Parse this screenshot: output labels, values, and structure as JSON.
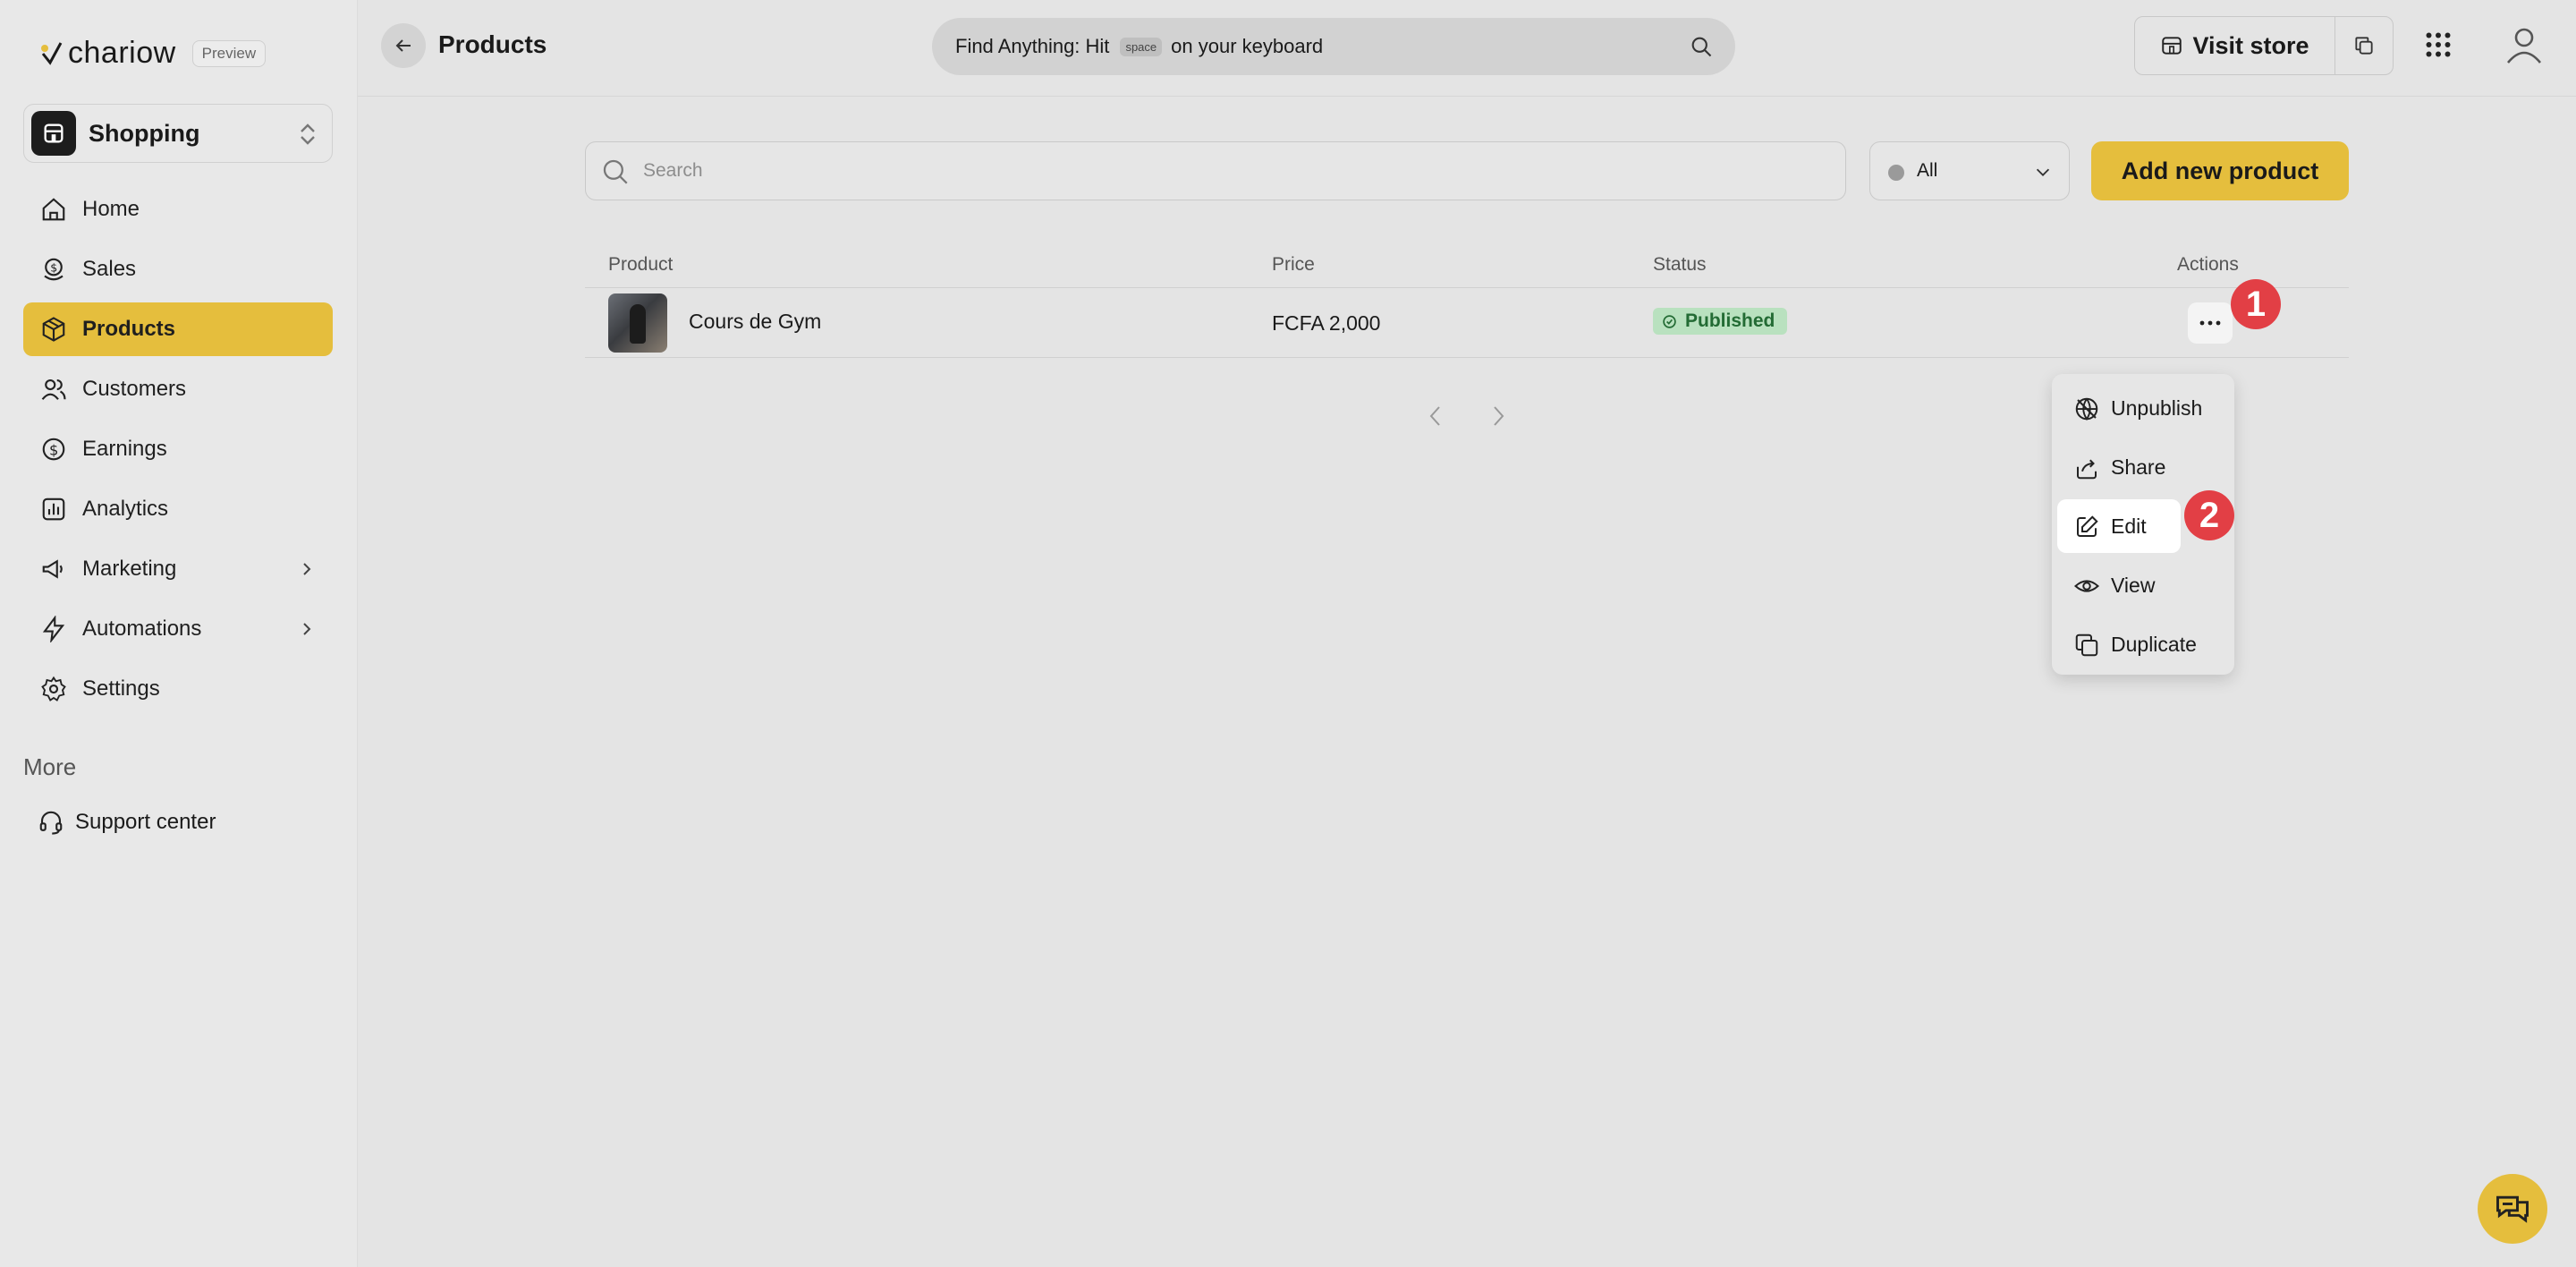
{
  "brand": {
    "name": "chariow",
    "badge": "Preview",
    "accent_color": "#e5be3d"
  },
  "store": {
    "name": "Shopping"
  },
  "sidebar": {
    "items": [
      {
        "label": "Home",
        "icon": "home-icon"
      },
      {
        "label": "Sales",
        "icon": "coins-icon"
      },
      {
        "label": "Products",
        "icon": "package-icon",
        "active": true
      },
      {
        "label": "Customers",
        "icon": "users-icon"
      },
      {
        "label": "Earnings",
        "icon": "dollar-circle-icon"
      },
      {
        "label": "Analytics",
        "icon": "bar-chart-icon"
      },
      {
        "label": "Marketing",
        "icon": "megaphone-icon",
        "expandable": true
      },
      {
        "label": "Automations",
        "icon": "lightning-icon",
        "expandable": true
      },
      {
        "label": "Settings",
        "icon": "gear-icon"
      }
    ],
    "more_label": "More",
    "support_label": "Support center"
  },
  "topbar": {
    "title": "Products",
    "find": {
      "prefix": "Find Anything: Hit",
      "key": "space",
      "suffix": "on your keyboard"
    },
    "visit_store": "Visit store"
  },
  "toolbar": {
    "search_placeholder": "Search",
    "filter_value": "All",
    "add_button": "Add new product"
  },
  "table": {
    "columns": [
      "Product",
      "Price",
      "Status",
      "Actions"
    ],
    "rows": [
      {
        "name": "Cours de Gym",
        "price": "FCFA 2,000",
        "status": "Published"
      }
    ]
  },
  "markers": [
    "1",
    "2"
  ],
  "actions_menu": {
    "items": [
      {
        "label": "Unpublish",
        "icon": "globe-off-icon"
      },
      {
        "label": "Share",
        "icon": "share-icon"
      },
      {
        "label": "Edit",
        "icon": "edit-icon",
        "highlighted": true
      },
      {
        "label": "View",
        "icon": "eye-icon"
      },
      {
        "label": "Duplicate",
        "icon": "copy-icon"
      }
    ]
  }
}
